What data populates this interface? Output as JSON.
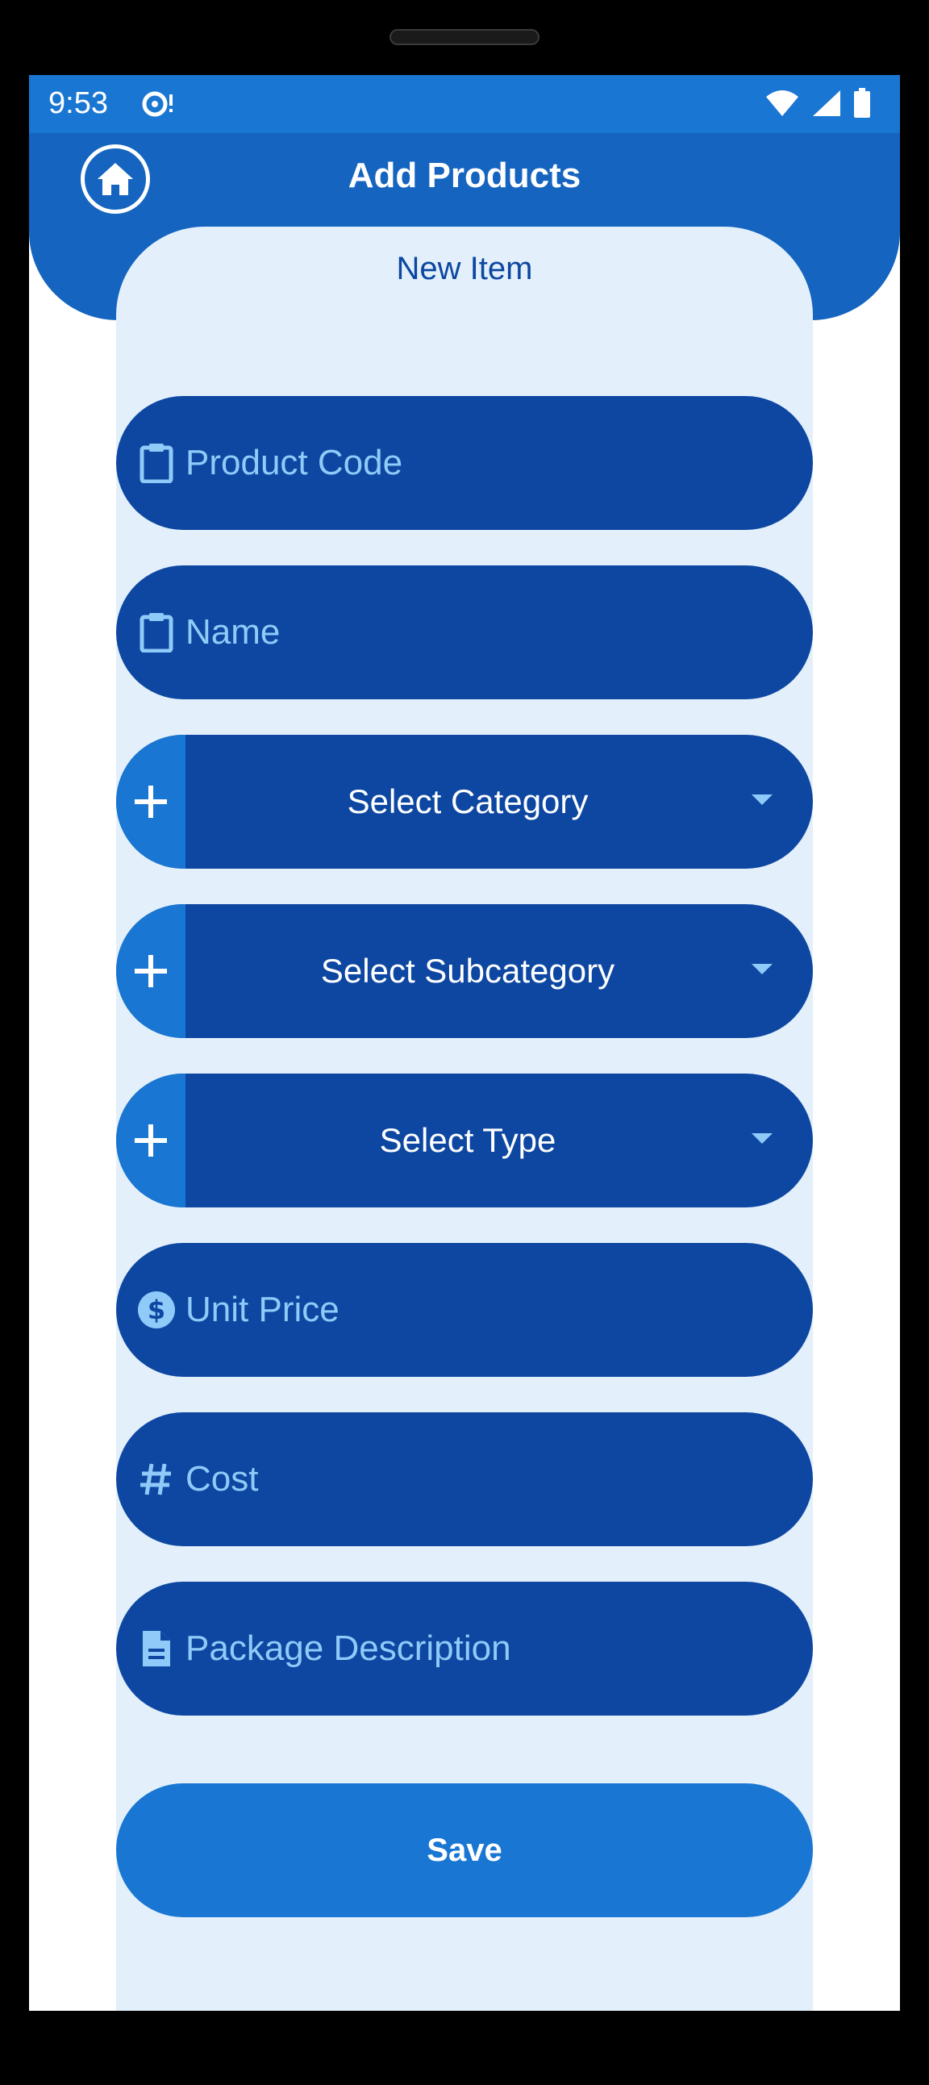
{
  "status": {
    "time": "9:53",
    "icons": [
      "notification-icon",
      "wifi-icon",
      "signal-icon",
      "battery-icon"
    ]
  },
  "appbar": {
    "title": "Add Products",
    "home_icon": "home-icon"
  },
  "form": {
    "title": "New Item",
    "product_code_placeholder": "Product Code",
    "name_placeholder": "Name",
    "category_label": "Select Category",
    "subcategory_label": "Select Subcategory",
    "type_label": "Select Type",
    "unit_price_placeholder": "Unit Price",
    "cost_placeholder": "Cost",
    "package_description_placeholder": "Package Description",
    "save_label": "Save"
  },
  "colors": {
    "primary": "#1976d2",
    "appbar": "#1565c0",
    "field_bg": "#0d47a1",
    "card_bg": "#e3f0fb",
    "placeholder": "#90caf9"
  }
}
